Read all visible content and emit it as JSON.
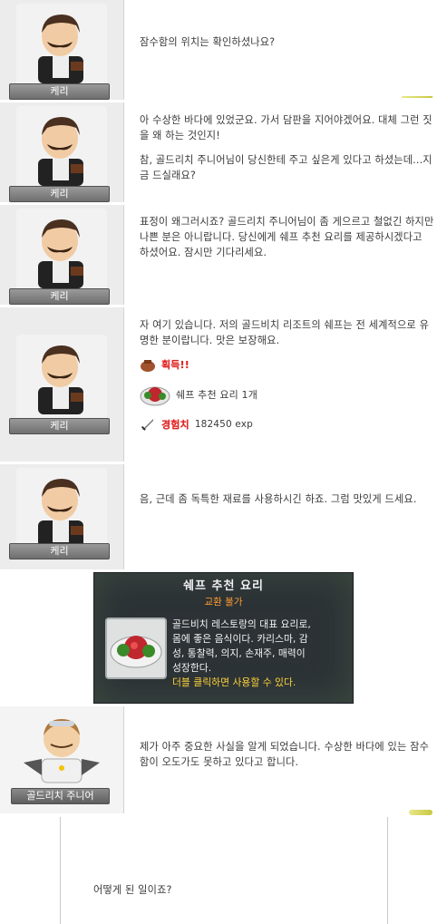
{
  "dialogs": [
    {
      "npc": "케리",
      "paragraphs": [
        "잠수함의 위치는 확인하셨나요?"
      ]
    },
    {
      "npc": "케리",
      "paragraphs": [
        "아 수상한 바다에 있었군요. 가서 담판을 지어야겠어요. 대체 그런 짓을 왜 하는 것인지!",
        "참, 골드리치 주니어님이 당신한테 주고 싶은게 있다고 하셨는데...지금 드실래요?"
      ]
    },
    {
      "npc": "케리",
      "paragraphs": [
        "표정이 왜그러시죠? 골드리치 주니어님이 좀 게으르고 철없긴 하지만 나쁜 분은 아니랍니다. 당신에게 쉐프 추천 요리를 제공하시겠다고 하셨어요. 잠시만 기다리세요."
      ]
    },
    {
      "npc": "케리",
      "paragraphs": [
        "자 여기 있습니다. 저의 골드비치 리조트의 쉐프는 전 세계적으로 유명한 분이랍니다. 맛은 보장해요."
      ],
      "reward": {
        "title": "획득!!",
        "item": "쉐프 추천 요리 1개",
        "exp_label": "경험치",
        "exp_value": "182450 exp"
      }
    },
    {
      "npc": "케리",
      "paragraphs": [
        "음, 근데 좀 독특한 재료를 사용하시긴 하죠. 그럼 맛있게 드세요."
      ]
    },
    {
      "npc": "골드리치 주니어",
      "paragraphs": [
        "제가 아주 중요한 사실을 알게 되었습니다. 수상한 바다에 있는 잠수함이 오도가도 못하고 있다고 합니다."
      ]
    }
  ],
  "tooltip": {
    "title": "쉐프 추천 요리",
    "subtitle": "교환 불가",
    "desc_lines": [
      "골드비치 레스토랑의 대표 요리로,",
      "몸에 좋은 음식이다. 카리스마, 감",
      "성, 통찰력, 의지, 손재주, 매력이",
      "성장한다."
    ],
    "hint": "더블 클릭하면 사용할 수 있다."
  },
  "final_message": "어떻게 된 일이죠?",
  "colors": {
    "name_bar": "#7a7a7a",
    "portrait_bg": "#ececec",
    "reward_red": "#dd2222",
    "tooltip_bg": "#2c3236",
    "tooltip_orange": "#ff9b30",
    "tooltip_yellow": "#ffd23a"
  }
}
